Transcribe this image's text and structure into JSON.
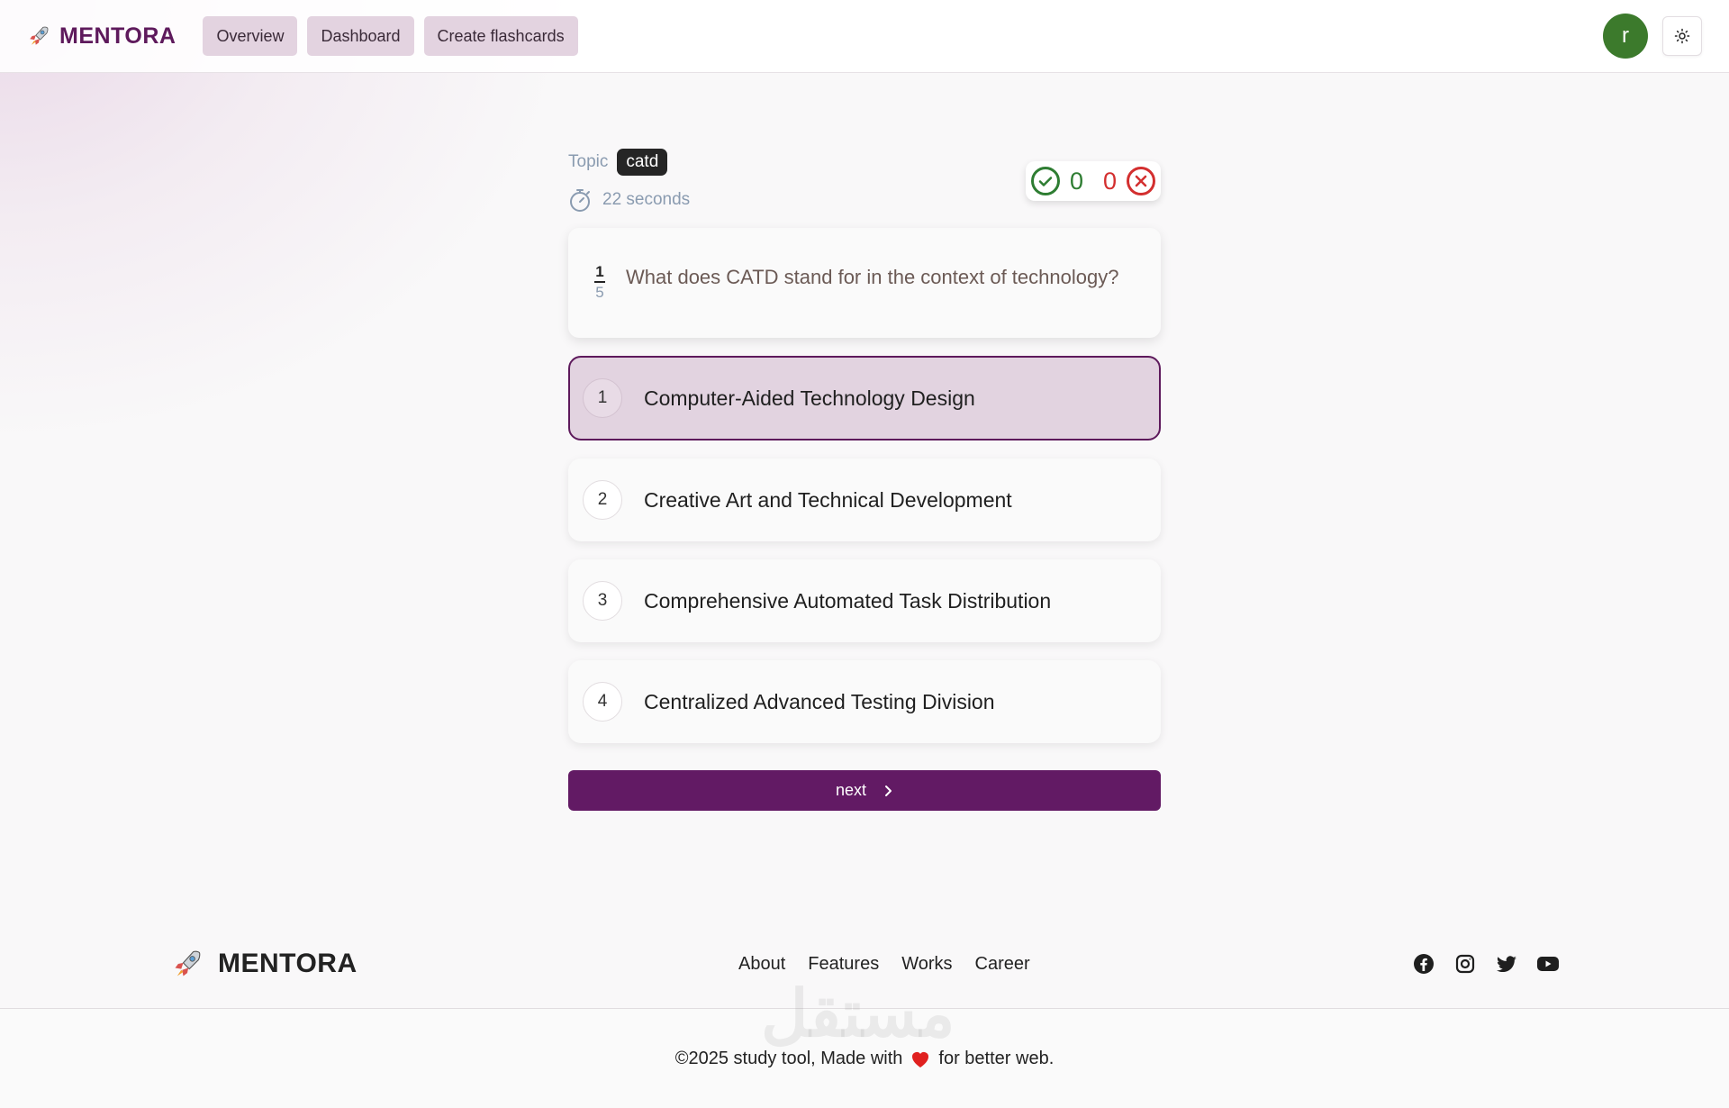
{
  "header": {
    "brand": "MENTORA",
    "nav": [
      "Overview",
      "Dashboard",
      "Create flashcards"
    ],
    "avatar_initial": "r",
    "icons": {
      "logo": "rocket-icon",
      "theme": "sun-icon"
    }
  },
  "quiz": {
    "topic_label": "Topic",
    "topic": "catd",
    "timer": "22 seconds",
    "score": {
      "correct": "0",
      "wrong": "0"
    },
    "question_index": "1",
    "question_total": "5",
    "question": "What does CATD stand for in the context of technology?",
    "options": [
      {
        "number": "1",
        "text": "Computer-Aided Technology Design",
        "selected": true
      },
      {
        "number": "2",
        "text": "Creative Art and Technical Development",
        "selected": false
      },
      {
        "number": "3",
        "text": "Comprehensive Automated Task Distribution",
        "selected": false
      },
      {
        "number": "4",
        "text": "Centralized Advanced Testing Division",
        "selected": false
      }
    ],
    "next_label": "next"
  },
  "footer": {
    "brand": "MENTORA",
    "links": [
      "About",
      "Features",
      "Works",
      "Career"
    ],
    "socials": [
      "facebook-icon",
      "instagram-icon",
      "twitter-icon",
      "youtube-icon"
    ],
    "copyright_pre": "©2025 study tool, Made with",
    "copyright_post": "for better web.",
    "watermark": "مستقل"
  },
  "colors": {
    "brand": "#5e1a5c",
    "nav_bg": "#e3d3e0",
    "primary_button": "#621a64",
    "correct": "#2e7d32",
    "wrong": "#d32f2f",
    "avatar": "#3c7a2c"
  }
}
